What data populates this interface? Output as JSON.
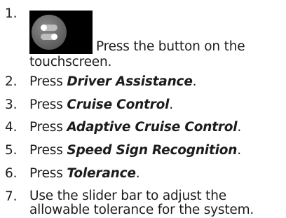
{
  "instructions": {
    "steps": [
      {
        "number": "1.",
        "icon": "settings-toggle-icon",
        "text_line1": "Press the button on the",
        "text_line2": "touchscreen."
      },
      {
        "number": "2.",
        "prefix": "Press ",
        "bold": "Driver Assistance",
        "suffix": "."
      },
      {
        "number": "3.",
        "prefix": "Press ",
        "bold": "Cruise Control",
        "suffix": "."
      },
      {
        "number": "4.",
        "prefix": "Press ",
        "bold": "Adaptive Cruise Control",
        "suffix": "."
      },
      {
        "number": "5.",
        "prefix": "Press ",
        "bold": "Speed Sign Recognition",
        "suffix": "."
      },
      {
        "number": "6.",
        "prefix": "Press ",
        "bold": "Tolerance",
        "suffix": "."
      },
      {
        "number": "7.",
        "text_line1": "Use the slider bar to adjust the",
        "text_line2": "allowable tolerance for the system."
      }
    ]
  },
  "colors": {
    "text": "#1c1c1c",
    "icon_background": "#000000",
    "icon_circle": "#6e6e6e",
    "icon_toggle": "#ffffff"
  }
}
